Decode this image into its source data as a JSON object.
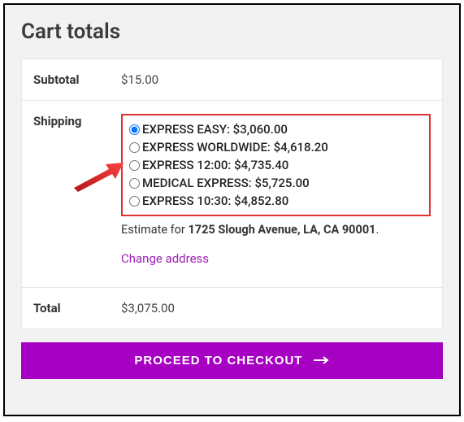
{
  "title": "Cart totals",
  "rows": {
    "subtotal_label": "Subtotal",
    "subtotal_value": "$15.00",
    "shipping_label": "Shipping",
    "total_label": "Total",
    "total_value": "$3,075.00"
  },
  "shipping_options": [
    {
      "label": "EXPRESS EASY: $3,060.00",
      "selected": true
    },
    {
      "label": "EXPRESS WORLDWIDE: $4,618.20",
      "selected": false
    },
    {
      "label": "EXPRESS 12:00: $4,735.40",
      "selected": false
    },
    {
      "label": "MEDICAL EXPRESS: $5,725.00",
      "selected": false
    },
    {
      "label": "EXPRESS 10:30: $4,852.80",
      "selected": false
    }
  ],
  "estimate_prefix": "Estimate for ",
  "estimate_address": "1725 Slough Avenue, LA, CA 90001",
  "change_address_label": "Change address",
  "checkout_label": "PROCEED TO CHECKOUT"
}
